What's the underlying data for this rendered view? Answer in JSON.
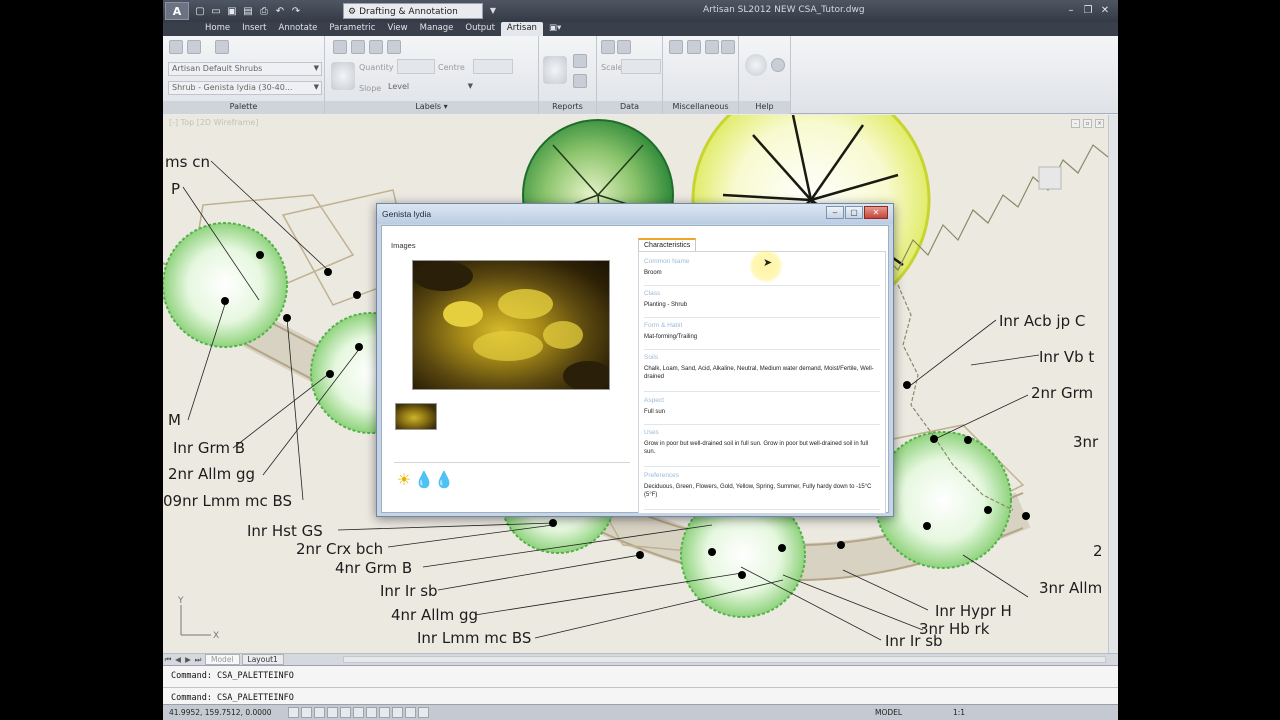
{
  "window": {
    "title": "Artisan SL2012    NEW CSA_Tutor.dwg",
    "workspace": "Drafting & Annotation",
    "logo": "A"
  },
  "quick_access": [
    "new-icon",
    "open-icon",
    "save-icon",
    "saveas-icon",
    "print-icon",
    "undo-icon",
    "redo-icon"
  ],
  "ribbon": {
    "tabs": [
      "Home",
      "Insert",
      "Annotate",
      "Parametric",
      "View",
      "Manage",
      "Output",
      "Artisan",
      "▣▾"
    ],
    "active_tab": "Artisan",
    "palette": {
      "title": "Palette",
      "combo1": "Artisan Default Shrubs",
      "combo2": "Shrub - Genista lydia (30-40..."
    },
    "labels": {
      "title": "Labels ▾",
      "quantity_label": "Quantity",
      "centre_label": "Centre",
      "slope_label": "Slope",
      "slope_value": "Level"
    },
    "reports": {
      "title": "Reports"
    },
    "data": {
      "title": "Data",
      "scale_label": "Scale"
    },
    "misc": {
      "title": "Miscellaneous"
    },
    "help": {
      "title": "Help"
    }
  },
  "drawing": {
    "viewport_label": "[-] Top [2D Wireframe]",
    "labels": [
      "ms cn",
      "P",
      "M",
      "Inr Grm B",
      "2nr Allm gg",
      "09nr Lmm mc BS",
      "Inr Hst GS",
      "2nr Crx bch",
      "4nr Grm B",
      "Inr Ir sb",
      "4nr Allm gg",
      "Inr Lmm mc BS",
      "Inr Acb jp C",
      "Inr Vb t",
      "2nr Grm",
      "3nr",
      "2",
      "3nr Allm",
      "Inr Hypr H",
      "3nr Hb rk",
      "Inr Ir sb"
    ]
  },
  "layout_tabs": [
    "Model",
    "Layout1"
  ],
  "command": {
    "history": "Command: CSA_PALETTEINFO",
    "current": "Command: CSA_PALETTEINFO"
  },
  "status": {
    "coords": "41.9952, 159.7512, 0.0000",
    "model": "MODEL",
    "scale": "1:1"
  },
  "dialog": {
    "title": "Genista lydia",
    "images_label": "Images",
    "char_tab": "Characteristics",
    "requirement_icons": [
      "sun-icon",
      "water-full-icon",
      "water-empty-icon"
    ],
    "sections": [
      {
        "heading": "Common Name",
        "value": "Broom"
      },
      {
        "heading": "Class",
        "value": "Planting - Shrub"
      },
      {
        "heading": "Form & Habit",
        "value": "Mat-forming/Trailing"
      },
      {
        "heading": "Soils",
        "value": "Chalk, Loam, Sand, Acid, Alkaline, Neutral, Medium water demand, Moist/Fertile, Well-drained"
      },
      {
        "heading": "Aspect",
        "value": "Full sun"
      },
      {
        "heading": "Uses",
        "value": "Grow in poor but well-drained soil in full sun. Grow in poor but well-drained soil in full sun."
      },
      {
        "heading": "Preferences",
        "value": "Deciduous, Green, Flowers, Gold, Yellow, Spring, Summer, Fully hardy down to -15°C (5°F)"
      }
    ]
  },
  "colors": {
    "title_bar": "#3b414c",
    "drawing_bg": "#ece9e1",
    "plant_green": "#7bc46b",
    "linework": "#b5a883",
    "dialog_frame": "#c6d5e6",
    "tab_accent": "#f1a628"
  }
}
